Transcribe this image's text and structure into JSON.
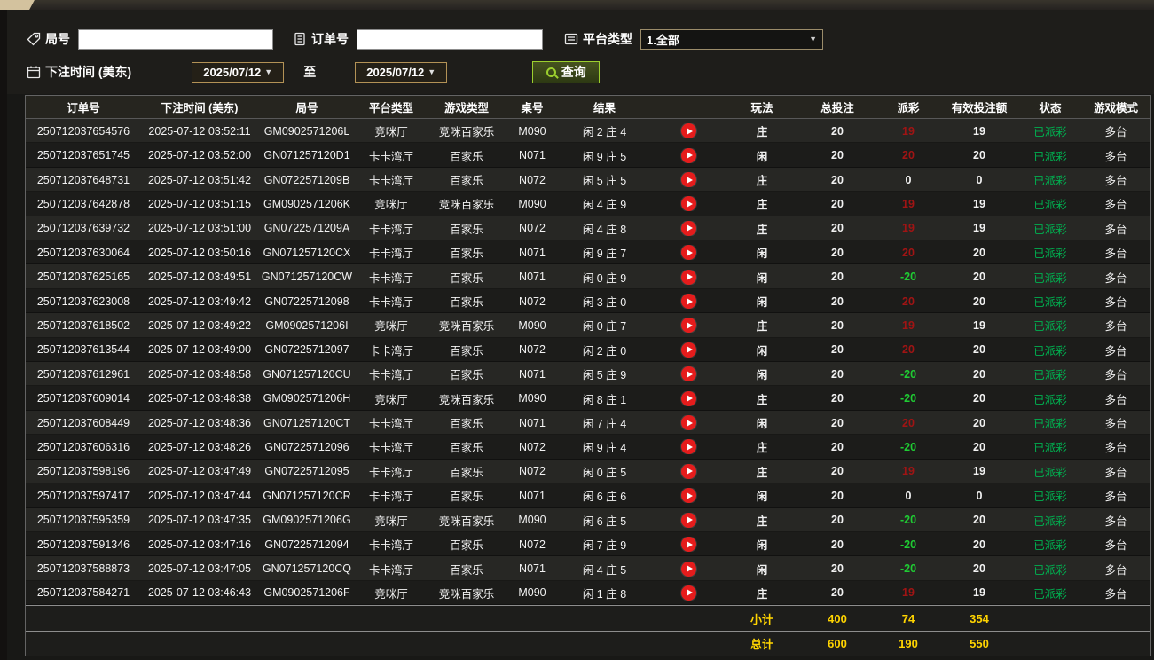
{
  "colors": {
    "payout_pos": "#a01414",
    "payout_neg": "#1fcc33",
    "status_green": "#00b050",
    "total_yellow": "#ffd400",
    "accent_border": "#b39256",
    "button_green": "#9ccf2e",
    "play_red": "#e51c1c"
  },
  "filters": {
    "round_label": "局号",
    "round_input_value": "",
    "order_label": "订单号",
    "order_input_value": "",
    "platform_label": "平台类型",
    "platform_value": "1.全部",
    "bet_time_label": "下注时间 (美东)",
    "date_from": "2025/07/12",
    "to_label": "至",
    "date_to": "2025/07/12",
    "query_label": "查询"
  },
  "table": {
    "headers": [
      "订单号",
      "下注时间 (美东)",
      "局号",
      "平台类型",
      "游戏类型",
      "桌号",
      "结果",
      "",
      "玩法",
      "总投注",
      "派彩",
      "有效投注额",
      "状态",
      "游戏模式"
    ],
    "rows": [
      {
        "order": "250712037654576",
        "time": "2025-07-12 03:52:11",
        "round": "GM0902571206L",
        "platform": "竞咪厅",
        "game": "竞咪百家乐",
        "table": "M090",
        "result": "闲 2 庄 4",
        "side": "庄",
        "bet": "20",
        "payout": "19",
        "valid": "19",
        "status": "已派彩",
        "mode": "多台"
      },
      {
        "order": "250712037651745",
        "time": "2025-07-12 03:52:00",
        "round": "GN071257120D1",
        "platform": "卡卡湾厅",
        "game": "百家乐",
        "table": "N071",
        "result": "闲 9 庄 5",
        "side": "闲",
        "bet": "20",
        "payout": "20",
        "valid": "20",
        "status": "已派彩",
        "mode": "多台"
      },
      {
        "order": "250712037648731",
        "time": "2025-07-12 03:51:42",
        "round": "GN0722571209B",
        "platform": "卡卡湾厅",
        "game": "百家乐",
        "table": "N072",
        "result": "闲 5 庄 5",
        "side": "庄",
        "bet": "20",
        "payout": "0",
        "valid": "0",
        "status": "已派彩",
        "mode": "多台"
      },
      {
        "order": "250712037642878",
        "time": "2025-07-12 03:51:15",
        "round": "GM0902571206K",
        "platform": "竞咪厅",
        "game": "竞咪百家乐",
        "table": "M090",
        "result": "闲 4 庄 9",
        "side": "庄",
        "bet": "20",
        "payout": "19",
        "valid": "19",
        "status": "已派彩",
        "mode": "多台"
      },
      {
        "order": "250712037639732",
        "time": "2025-07-12 03:51:00",
        "round": "GN0722571209A",
        "platform": "卡卡湾厅",
        "game": "百家乐",
        "table": "N072",
        "result": "闲 4 庄 8",
        "side": "庄",
        "bet": "20",
        "payout": "19",
        "valid": "19",
        "status": "已派彩",
        "mode": "多台"
      },
      {
        "order": "250712037630064",
        "time": "2025-07-12 03:50:16",
        "round": "GN071257120CX",
        "platform": "卡卡湾厅",
        "game": "百家乐",
        "table": "N071",
        "result": "闲 9 庄 7",
        "side": "闲",
        "bet": "20",
        "payout": "20",
        "valid": "20",
        "status": "已派彩",
        "mode": "多台"
      },
      {
        "order": "250712037625165",
        "time": "2025-07-12 03:49:51",
        "round": "GN071257120CW",
        "platform": "卡卡湾厅",
        "game": "百家乐",
        "table": "N071",
        "result": "闲 0 庄 9",
        "side": "闲",
        "bet": "20",
        "payout": "-20",
        "valid": "20",
        "status": "已派彩",
        "mode": "多台"
      },
      {
        "order": "250712037623008",
        "time": "2025-07-12 03:49:42",
        "round": "GN07225712098",
        "platform": "卡卡湾厅",
        "game": "百家乐",
        "table": "N072",
        "result": "闲 3 庄 0",
        "side": "闲",
        "bet": "20",
        "payout": "20",
        "valid": "20",
        "status": "已派彩",
        "mode": "多台"
      },
      {
        "order": "250712037618502",
        "time": "2025-07-12 03:49:22",
        "round": "GM0902571206I",
        "platform": "竞咪厅",
        "game": "竞咪百家乐",
        "table": "M090",
        "result": "闲 0 庄 7",
        "side": "庄",
        "bet": "20",
        "payout": "19",
        "valid": "19",
        "status": "已派彩",
        "mode": "多台"
      },
      {
        "order": "250712037613544",
        "time": "2025-07-12 03:49:00",
        "round": "GN07225712097",
        "platform": "卡卡湾厅",
        "game": "百家乐",
        "table": "N072",
        "result": "闲 2 庄 0",
        "side": "闲",
        "bet": "20",
        "payout": "20",
        "valid": "20",
        "status": "已派彩",
        "mode": "多台"
      },
      {
        "order": "250712037612961",
        "time": "2025-07-12 03:48:58",
        "round": "GN071257120CU",
        "platform": "卡卡湾厅",
        "game": "百家乐",
        "table": "N071",
        "result": "闲 5 庄 9",
        "side": "闲",
        "bet": "20",
        "payout": "-20",
        "valid": "20",
        "status": "已派彩",
        "mode": "多台"
      },
      {
        "order": "250712037609014",
        "time": "2025-07-12 03:48:38",
        "round": "GM0902571206H",
        "platform": "竞咪厅",
        "game": "竞咪百家乐",
        "table": "M090",
        "result": "闲 8 庄 1",
        "side": "庄",
        "bet": "20",
        "payout": "-20",
        "valid": "20",
        "status": "已派彩",
        "mode": "多台"
      },
      {
        "order": "250712037608449",
        "time": "2025-07-12 03:48:36",
        "round": "GN071257120CT",
        "platform": "卡卡湾厅",
        "game": "百家乐",
        "table": "N071",
        "result": "闲 7 庄 4",
        "side": "闲",
        "bet": "20",
        "payout": "20",
        "valid": "20",
        "status": "已派彩",
        "mode": "多台"
      },
      {
        "order": "250712037606316",
        "time": "2025-07-12 03:48:26",
        "round": "GN07225712096",
        "platform": "卡卡湾厅",
        "game": "百家乐",
        "table": "N072",
        "result": "闲 9 庄 4",
        "side": "庄",
        "bet": "20",
        "payout": "-20",
        "valid": "20",
        "status": "已派彩",
        "mode": "多台"
      },
      {
        "order": "250712037598196",
        "time": "2025-07-12 03:47:49",
        "round": "GN07225712095",
        "platform": "卡卡湾厅",
        "game": "百家乐",
        "table": "N072",
        "result": "闲 0 庄 5",
        "side": "庄",
        "bet": "20",
        "payout": "19",
        "valid": "19",
        "status": "已派彩",
        "mode": "多台"
      },
      {
        "order": "250712037597417",
        "time": "2025-07-12 03:47:44",
        "round": "GN071257120CR",
        "platform": "卡卡湾厅",
        "game": "百家乐",
        "table": "N071",
        "result": "闲 6 庄 6",
        "side": "闲",
        "bet": "20",
        "payout": "0",
        "valid": "0",
        "status": "已派彩",
        "mode": "多台"
      },
      {
        "order": "250712037595359",
        "time": "2025-07-12 03:47:35",
        "round": "GM0902571206G",
        "platform": "竞咪厅",
        "game": "竞咪百家乐",
        "table": "M090",
        "result": "闲 6 庄 5",
        "side": "庄",
        "bet": "20",
        "payout": "-20",
        "valid": "20",
        "status": "已派彩",
        "mode": "多台"
      },
      {
        "order": "250712037591346",
        "time": "2025-07-12 03:47:16",
        "round": "GN07225712094",
        "platform": "卡卡湾厅",
        "game": "百家乐",
        "table": "N072",
        "result": "闲 7 庄 9",
        "side": "闲",
        "bet": "20",
        "payout": "-20",
        "valid": "20",
        "status": "已派彩",
        "mode": "多台"
      },
      {
        "order": "250712037588873",
        "time": "2025-07-12 03:47:05",
        "round": "GN071257120CQ",
        "platform": "卡卡湾厅",
        "game": "百家乐",
        "table": "N071",
        "result": "闲 4 庄 5",
        "side": "闲",
        "bet": "20",
        "payout": "-20",
        "valid": "20",
        "status": "已派彩",
        "mode": "多台"
      },
      {
        "order": "250712037584271",
        "time": "2025-07-12 03:46:43",
        "round": "GM0902571206F",
        "platform": "竞咪厅",
        "game": "竞咪百家乐",
        "table": "M090",
        "result": "闲 1 庄 8",
        "side": "庄",
        "bet": "20",
        "payout": "19",
        "valid": "19",
        "status": "已派彩",
        "mode": "多台"
      }
    ],
    "subtotal": {
      "label": "小计",
      "total_bet": "400",
      "payout": "74",
      "valid_bet": "354"
    },
    "total": {
      "label": "总计",
      "total_bet": "600",
      "payout": "190",
      "valid_bet": "550"
    }
  }
}
